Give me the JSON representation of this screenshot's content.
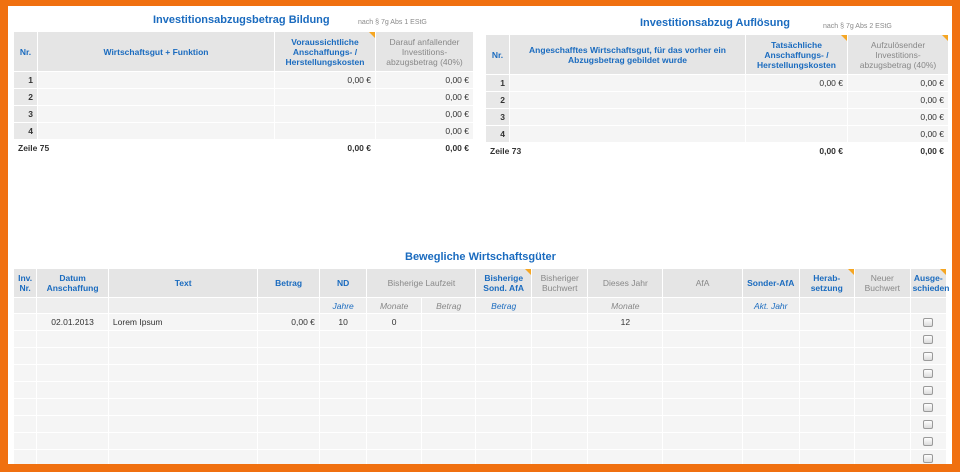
{
  "left": {
    "title": "Investitionsabzugsbetrag Bildung",
    "subtitle": "nach § 7g Abs 1 EStG",
    "headers": [
      "Nr.",
      "Wirtschaftsgut + Funktion",
      "Voraussichtliche Anschaffungs- / Herstellungskosten",
      "Darauf anfallender Investitions-abzugsbetrag (40%)"
    ],
    "rows": [
      {
        "nr": "1",
        "cost": "0,00 €",
        "amount": "0,00 €"
      },
      {
        "nr": "2",
        "cost": "",
        "amount": "0,00 €"
      },
      {
        "nr": "3",
        "cost": "",
        "amount": "0,00 €"
      },
      {
        "nr": "4",
        "cost": "",
        "amount": "0,00 €"
      }
    ],
    "total": {
      "label": "Zeile 75",
      "cost": "0,00 €",
      "amount": "0,00 €"
    }
  },
  "right": {
    "title": "Investitionsabzug Auflösung",
    "subtitle": "nach § 7g Abs 2 EStG",
    "headers": [
      "Nr.",
      "Angeschafftes Wirtschaftsgut, für das vorher ein Abzugsbetrag gebildet wurde",
      "Tatsächliche Anschaffungs- / Herstellungskosten",
      "Aufzulösender Investitions-abzugsbetrag (40%)"
    ],
    "rows": [
      {
        "nr": "1",
        "cost": "0,00 €",
        "amount": "0,00 €"
      },
      {
        "nr": "2",
        "cost": "",
        "amount": "0,00 €"
      },
      {
        "nr": "3",
        "cost": "",
        "amount": "0,00 €"
      },
      {
        "nr": "4",
        "cost": "",
        "amount": "0,00 €"
      }
    ],
    "total": {
      "label": "Zeile 73",
      "cost": "0,00 €",
      "amount": "0,00 €"
    }
  },
  "bottom": {
    "title": "Bewegliche Wirtschaftsgüter",
    "headers": {
      "inv_nr": "Inv. Nr.",
      "datum": "Datum Anschaffung",
      "text": "Text",
      "betrag": "Betrag",
      "nd": "ND",
      "laufzeit": "Bisherige Laufzeit",
      "sond": "Bisherige Sond. AfA",
      "buchwert": "Bisheriger Buchwert",
      "dieses_jahr": "Dieses Jahr",
      "afa": "AfA",
      "sonder_afa": "Sonder-AfA",
      "herab": "Herab-setzung",
      "neuer_bw": "Neuer Buchwert",
      "ausgeschieden": "Ausge-schieden"
    },
    "subheaders": {
      "nd": "Jahre",
      "monate": "Monate",
      "betrag": "Betrag",
      "sond": "Betrag",
      "dieses_jahr": "Monate",
      "sonder_afa": "Akt. Jahr"
    },
    "rows": [
      {
        "datum": "02.01.2013",
        "text": "Lorem Ipsum",
        "betrag": "0,00 €",
        "nd": "10",
        "monate": "0",
        "dieses_jahr": "12"
      },
      {},
      {},
      {},
      {},
      {},
      {},
      {},
      {},
      {}
    ]
  },
  "colors": {
    "frame": "#f07010",
    "accent": "#1a6bbf",
    "header_bg": "#e5e5e5",
    "corner_marker": "#f5a623"
  }
}
